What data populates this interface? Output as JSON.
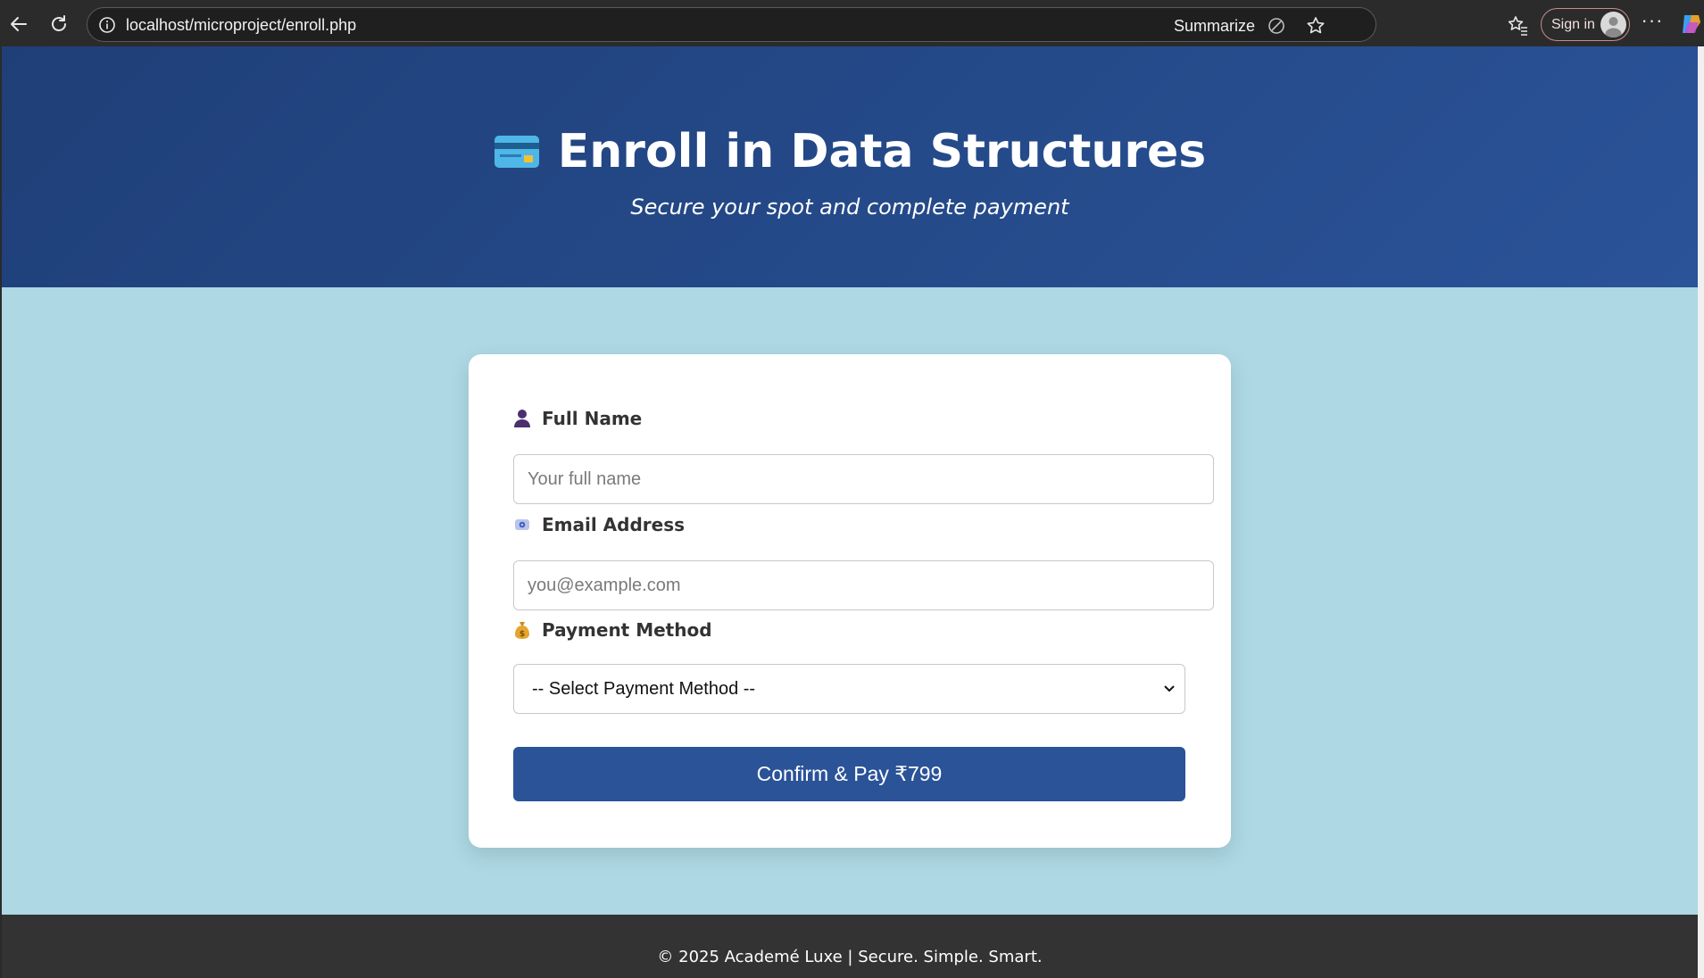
{
  "browser": {
    "url": "localhost/microproject/enroll.php",
    "summarize_label": "Summarize",
    "signin_label": "Sign in",
    "more_label": "···"
  },
  "hero": {
    "title": "Enroll in Data Structures",
    "subtitle": "Secure your spot and complete payment",
    "title_icon": "credit-card-icon"
  },
  "form": {
    "full_name": {
      "label": "Full Name",
      "placeholder": "Your full name",
      "icon": "person-icon"
    },
    "email": {
      "label": "Email Address",
      "placeholder": "you@example.com",
      "icon": "email-icon"
    },
    "payment": {
      "label": "Payment Method",
      "selected": "-- Select Payment Method --",
      "icon": "money-bag-icon"
    },
    "submit_label": "Confirm & Pay ₹799"
  },
  "footer": {
    "text": "© 2025 Academé Luxe | Secure. Simple. Smart."
  },
  "colors": {
    "hero_bg": "#234a8a",
    "page_bg": "#add8e4",
    "button_bg": "#2a5398",
    "footer_bg": "#333333"
  }
}
